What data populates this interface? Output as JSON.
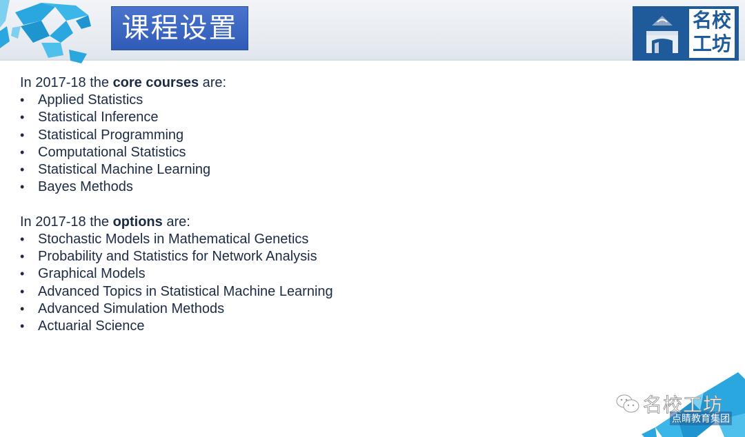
{
  "slide": {
    "title": "课程设置",
    "logo": {
      "text_line1": "名校",
      "text_line2": "工坊",
      "color": "#1f5b9a"
    },
    "core_section": {
      "intro_prefix": "In 2017-18 the ",
      "intro_bold": "core courses",
      "intro_suffix": " are:",
      "items": [
        "Applied Statistics",
        "Statistical Inference",
        "Statistical Programming",
        "Computational Statistics",
        "Statistical Machine Learning",
        "Bayes Methods"
      ]
    },
    "options_section": {
      "intro_prefix": "In 2017-18 the ",
      "intro_bold": "options",
      "intro_suffix": " are:",
      "items": [
        "Stochastic Models in Mathematical Genetics",
        "Probability and Statistics for Network Analysis",
        "Graphical Models",
        "Advanced Topics in Statistical Machine Learning",
        "Advanced Simulation Methods",
        "Actuarial Science"
      ]
    },
    "bullet_char": "•",
    "watermark": {
      "icon": "wechat-icon",
      "name": "名校工坊",
      "subtitle": "点睛教育集团"
    },
    "colors": {
      "title_bg": "#3a66c2",
      "text": "#1b2a45",
      "map_blue": "#2aa7df"
    }
  }
}
